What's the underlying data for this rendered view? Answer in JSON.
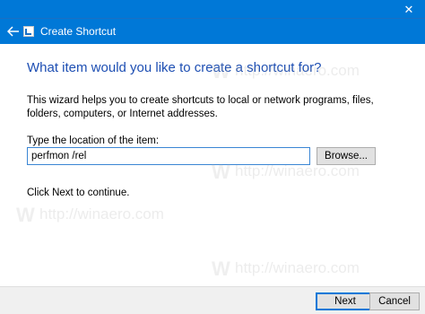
{
  "window": {
    "close_glyph": "✕"
  },
  "wizard": {
    "title": "Create Shortcut",
    "back_icon": "back-arrow-icon",
    "app_icon": "shortcut-wizard-icon"
  },
  "main": {
    "heading": "What item would you like to create a shortcut for?",
    "description": "This wizard helps you to create shortcuts to local or network programs, files, folders, computers, or Internet addresses.",
    "location_label": "Type the location of the item:",
    "location_value": "perfmon /rel",
    "browse_label": "Browse...",
    "continue_text": "Click Next to continue."
  },
  "footer": {
    "next_label": "Next",
    "cancel_label": "Cancel"
  },
  "watermark": {
    "logo_letter": "W",
    "url": "http://winaero.com"
  },
  "colors": {
    "titlebar": "#0078d7",
    "heading": "#1e4fb3",
    "input_border": "#3b86d4"
  }
}
